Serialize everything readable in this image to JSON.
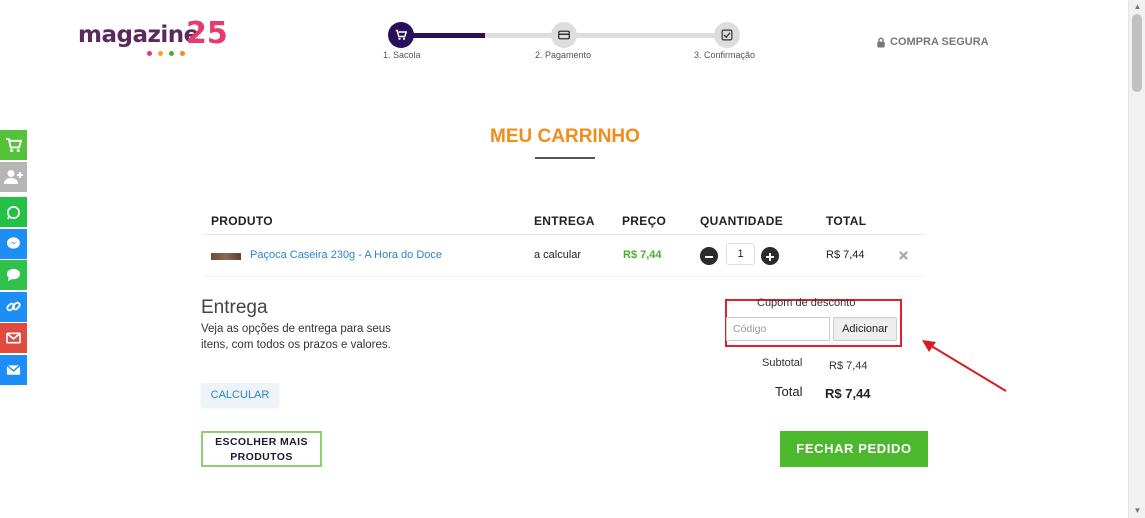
{
  "logo": {
    "word": "magazine",
    "number": "25",
    "dot_colors": [
      "#e63b6f",
      "#f5a623",
      "#4caf2c",
      "#f28c1a"
    ]
  },
  "steps": [
    {
      "label": "1. Sacola",
      "icon": "cart-icon",
      "active": true
    },
    {
      "label": "2. Pagamento",
      "icon": "card-icon",
      "active": false
    },
    {
      "label": "3. Confirmação",
      "icon": "check-icon",
      "active": false
    }
  ],
  "secure": {
    "label": "COMPRA SEGURA",
    "icon": "lock-icon"
  },
  "side_bar": [
    {
      "icon": "cart-icon",
      "color": "#55c33a"
    },
    {
      "icon": "user-plus-icon",
      "color": "#b5b5b5"
    },
    {
      "icon": "whatsapp-icon",
      "color": "#25c046"
    },
    {
      "icon": "messenger-icon",
      "color": "#1d8ef5"
    },
    {
      "icon": "chat-icon",
      "color": "#2fc14a"
    },
    {
      "icon": "link-icon",
      "color": "#1d8ef5"
    },
    {
      "icon": "mail-icon",
      "color": "#e04b3f"
    },
    {
      "icon": "envelope-icon",
      "color": "#1d8ef5"
    }
  ],
  "page_title": "MEU CARRINHO",
  "table": {
    "headers": {
      "product": "PRODUTO",
      "delivery": "ENTREGA",
      "price": "PREÇO",
      "quantity": "QUANTIDADE",
      "total": "TOTAL"
    },
    "rows": [
      {
        "product": "Paçoca Caseira 230g - A Hora do Doce",
        "delivery": "a calcular",
        "price": "R$ 7,44",
        "quantity": "1",
        "total": "R$ 7,44"
      }
    ]
  },
  "delivery": {
    "title": "Entrega",
    "text": "Veja as opções de entrega para seus itens, com todos os prazos e valores.",
    "calculate_label": "CALCULAR"
  },
  "more_products_label": "ESCOLHER MAIS PRODUTOS",
  "coupon": {
    "label": "Cupom de desconto",
    "placeholder": "Código",
    "add_label": "Adicionar"
  },
  "summary": {
    "subtotal_label": "Subtotal",
    "subtotal_value": "R$ 7,44",
    "total_label": "Total",
    "total_value": "R$ 7,44"
  },
  "checkout_label": "FECHAR PEDIDO",
  "colors": {
    "accent_orange": "#f28c1a",
    "brand_purple": "#2a0f5c",
    "green": "#4cb82d",
    "highlight_red": "#e0202a"
  }
}
